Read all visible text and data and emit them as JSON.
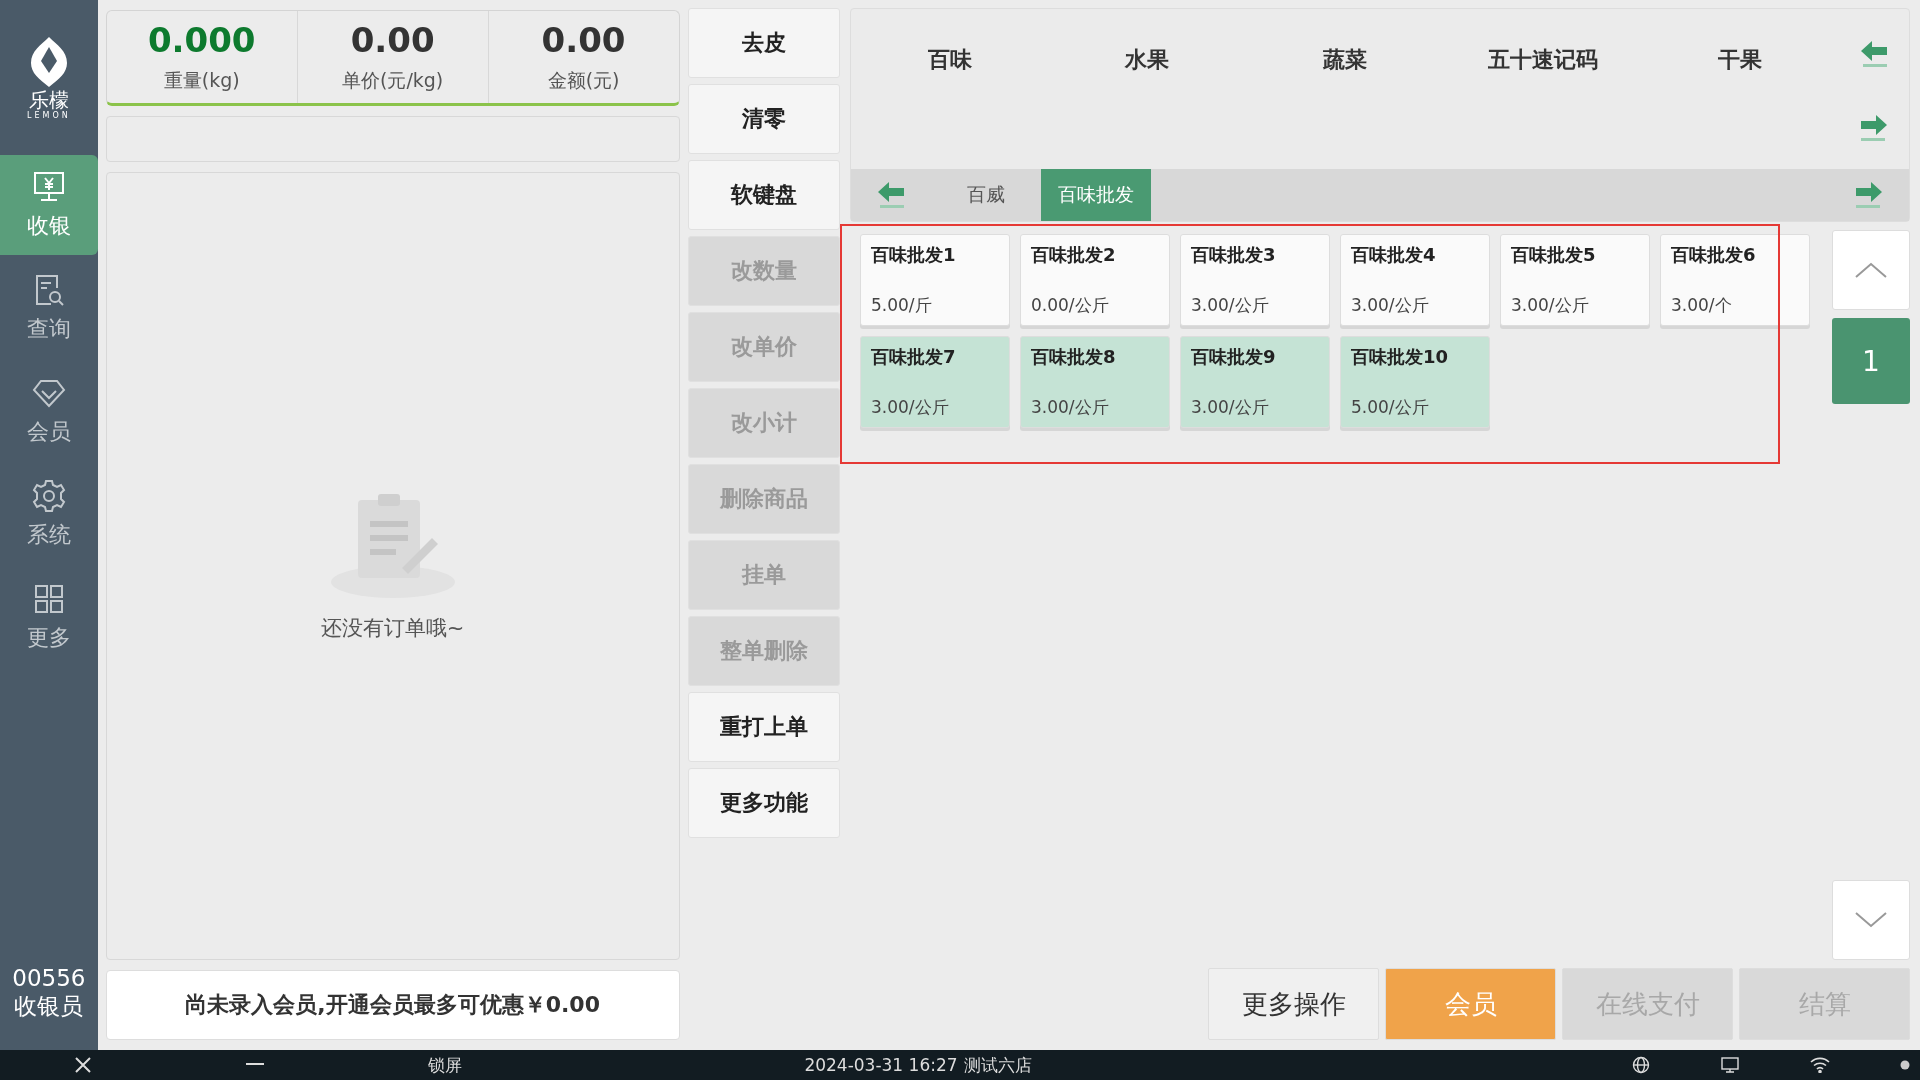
{
  "sidebar": {
    "logo_text": "乐檬",
    "logo_subtext": "LEMON",
    "items": [
      {
        "label": "收银",
        "kind": "register",
        "selected": true
      },
      {
        "label": "查询",
        "kind": "query",
        "selected": false
      },
      {
        "label": "会员",
        "kind": "member",
        "selected": false
      },
      {
        "label": "系统",
        "kind": "system",
        "selected": false
      },
      {
        "label": "更多",
        "kind": "more",
        "selected": false
      }
    ],
    "cashier_id": "00556",
    "cashier_role": "收银员"
  },
  "scale": [
    {
      "value": "0.000",
      "label": "重量(kg)",
      "highlighted": true
    },
    {
      "value": "0.00",
      "label": "单价(元/kg)",
      "highlighted": false
    },
    {
      "value": "0.00",
      "label": "金额(元)",
      "highlighted": false
    }
  ],
  "order_list": {
    "empty_text": "还没有订单哦~"
  },
  "member_bar": "尚未录入会员,开通会员最多可优惠￥0.00",
  "functions": [
    {
      "label": "去皮",
      "disabled": false
    },
    {
      "label": "清零",
      "disabled": false
    },
    {
      "label": "软键盘",
      "disabled": false
    },
    {
      "label": "改数量",
      "disabled": true
    },
    {
      "label": "改单价",
      "disabled": true
    },
    {
      "label": "改小计",
      "disabled": true
    },
    {
      "label": "删除商品",
      "disabled": true
    },
    {
      "label": "挂单",
      "disabled": true
    },
    {
      "label": "整单删除",
      "disabled": true
    },
    {
      "label": "重打上单",
      "disabled": false
    },
    {
      "label": "更多功能",
      "disabled": false
    }
  ],
  "categories": [
    {
      "label": "百味",
      "selected": false
    },
    {
      "label": "水果",
      "selected": false
    },
    {
      "label": "蔬菜",
      "selected": false
    },
    {
      "label": "五十速记码",
      "selected": false
    },
    {
      "label": "干果",
      "selected": false
    }
  ],
  "subcategories": [
    {
      "label": "百威",
      "selected": false
    },
    {
      "label": "百味批发",
      "selected": true
    }
  ],
  "products": [
    {
      "name": "百味批发1",
      "price": "5.00/斤",
      "highlighted": false
    },
    {
      "name": "百味批发2",
      "price": "0.00/公斤",
      "highlighted": false
    },
    {
      "name": "百味批发3",
      "price": "3.00/公斤",
      "highlighted": false
    },
    {
      "name": "百味批发4",
      "price": "3.00/公斤",
      "highlighted": false
    },
    {
      "name": "百味批发5",
      "price": "3.00/公斤",
      "highlighted": false
    },
    {
      "name": "百味批发6",
      "price": "3.00/个",
      "highlighted": false
    },
    {
      "name": "百味批发7",
      "price": "3.00/公斤",
      "highlighted": true
    },
    {
      "name": "百味批发8",
      "price": "3.00/公斤",
      "highlighted": true
    },
    {
      "name": "百味批发9",
      "price": "3.00/公斤",
      "highlighted": true
    },
    {
      "name": "百味批发10",
      "price": "5.00/公斤",
      "highlighted": true
    }
  ],
  "pager": {
    "page": "1"
  },
  "actions": [
    {
      "label": "更多操作",
      "kind": "default",
      "disabled": false
    },
    {
      "label": "会员",
      "kind": "primary",
      "disabled": false
    },
    {
      "label": "在线支付",
      "kind": "default",
      "disabled": true
    },
    {
      "label": "结算",
      "kind": "default",
      "disabled": true
    }
  ],
  "status_bar": {
    "lock": "锁屏",
    "datetime": "2024-03-31 16:27",
    "store": "测试六店"
  }
}
